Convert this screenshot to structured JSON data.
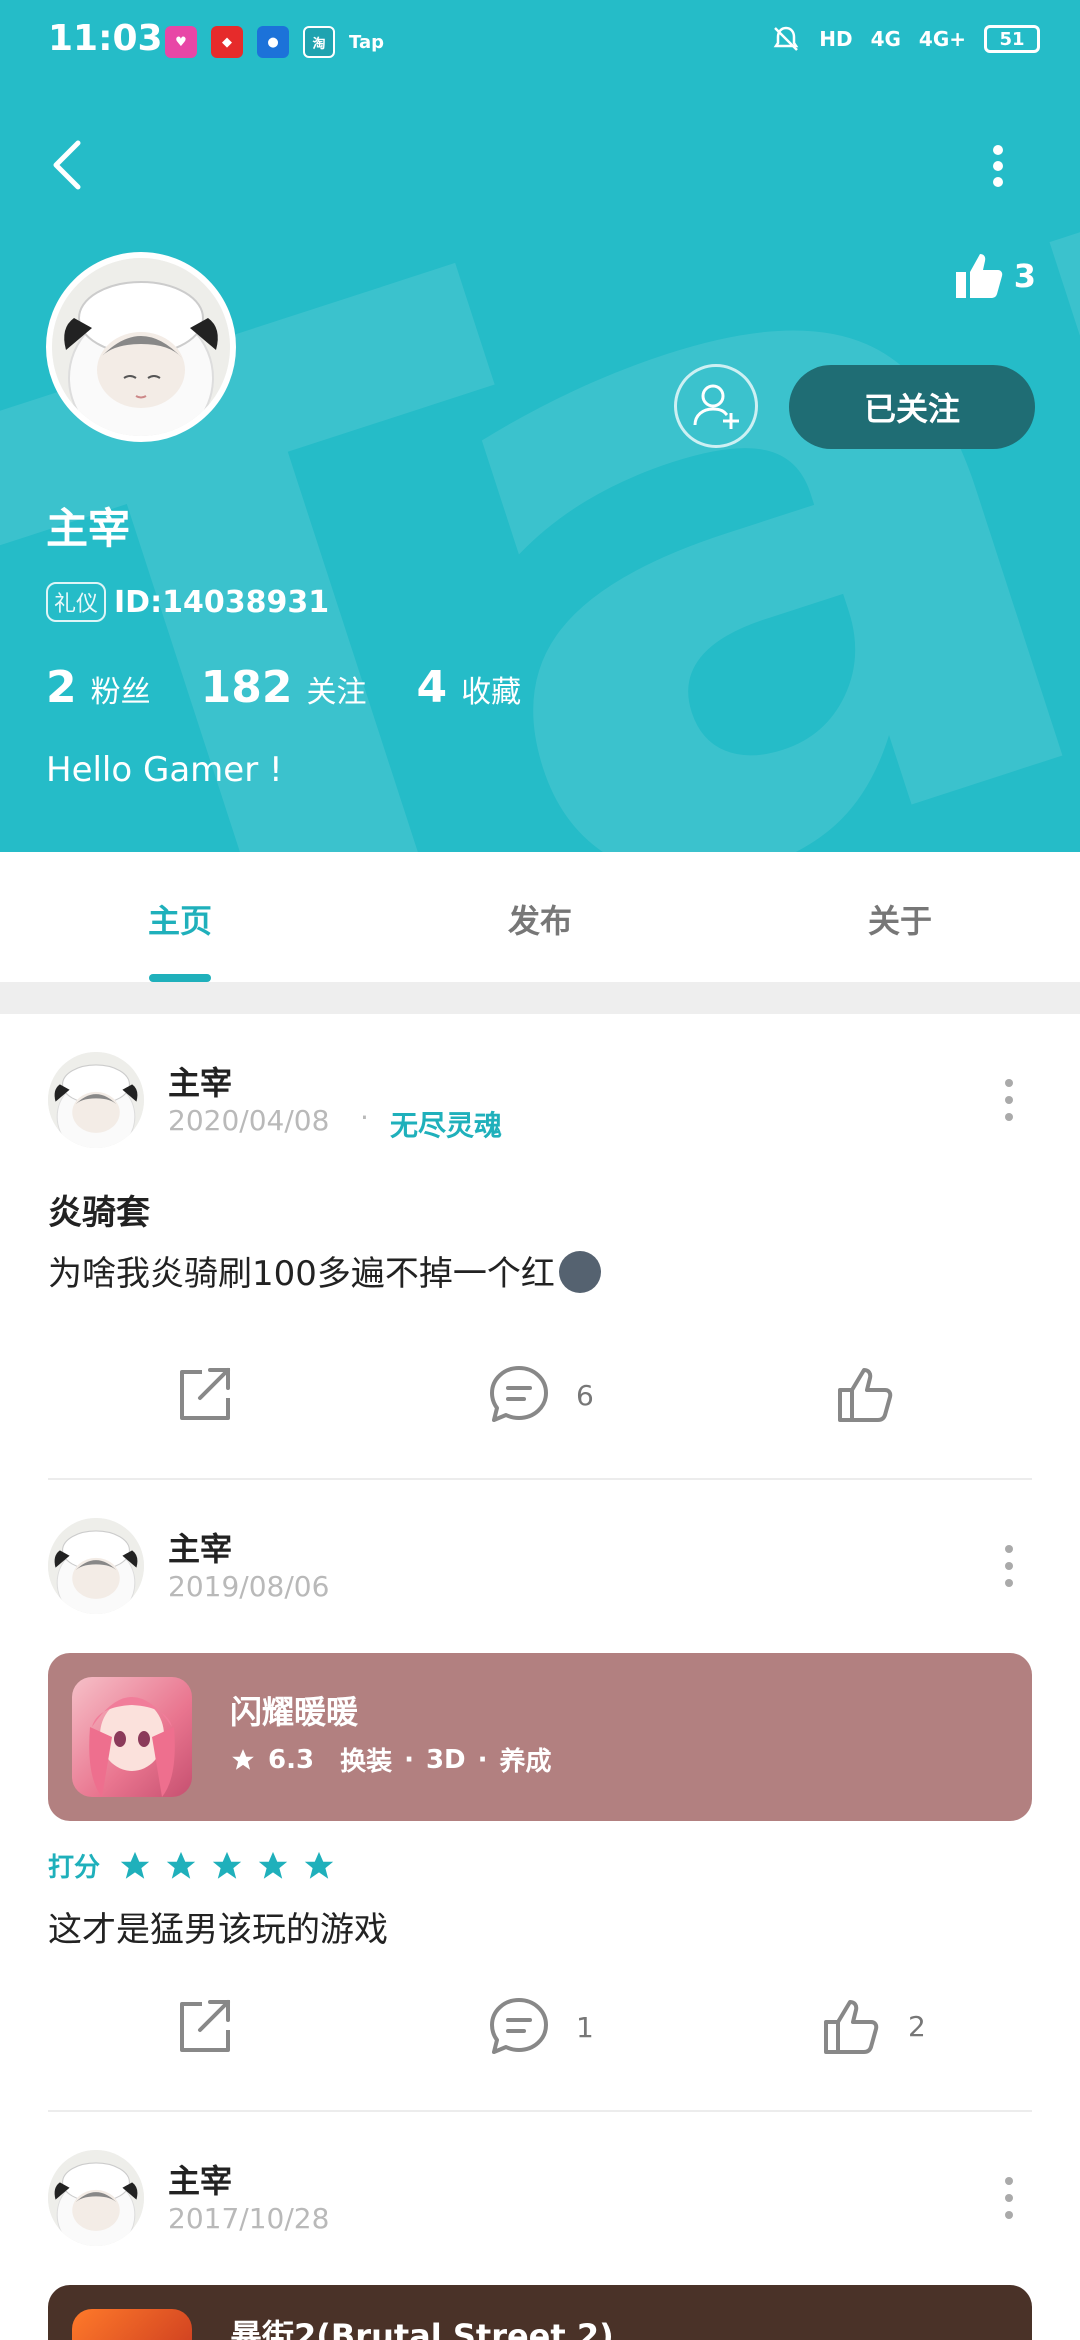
{
  "statusbar": {
    "time": "11:03",
    "notif_tap": "Tap",
    "notif_taobao": "淘",
    "signal_hd": "HD",
    "signal_4g_1": "4G",
    "signal_4g_2": "4G+",
    "battery": "51"
  },
  "profile": {
    "likes": "3",
    "follow_label": "已关注",
    "name": "主宰",
    "id_tag": "礼仪",
    "id_text": "ID:14038931",
    "stats": [
      {
        "n": "2",
        "label": "粉丝"
      },
      {
        "n": "182",
        "label": "关注"
      },
      {
        "n": "4",
        "label": "收藏"
      }
    ],
    "bio": "Hello Gamer !"
  },
  "tabs": [
    {
      "label": "主页",
      "active": true
    },
    {
      "label": "发布",
      "active": false
    },
    {
      "label": "关于",
      "active": false
    }
  ],
  "posts": [
    {
      "author": "主宰",
      "date": "2020/04/08",
      "game": "无尽灵魂",
      "title": "炎骑套",
      "body": "为啥我炎骑刷100多遍不掉一个红",
      "comments": "6",
      "likes": ""
    },
    {
      "author": "主宰",
      "date": "2019/08/06",
      "game_card": {
        "name": "闪耀暖暖",
        "score": "6.3",
        "tags": [
          "换装",
          "3D",
          "养成"
        ]
      },
      "rating_label": "打分",
      "stars": 5,
      "body": "这才是猛男该玩的游戏",
      "comments": "1",
      "likes": "2"
    },
    {
      "author": "主宰",
      "date": "2017/10/28",
      "game_card": {
        "name": "暴街2(Brutal Street 2)"
      }
    }
  ],
  "colors": {
    "header_bg": "#25bcc8",
    "accent": "#1fb0bb",
    "follow_btn": "#1f6d74",
    "game_card_1": "#b28080",
    "game_card_2": "#4a3228"
  }
}
